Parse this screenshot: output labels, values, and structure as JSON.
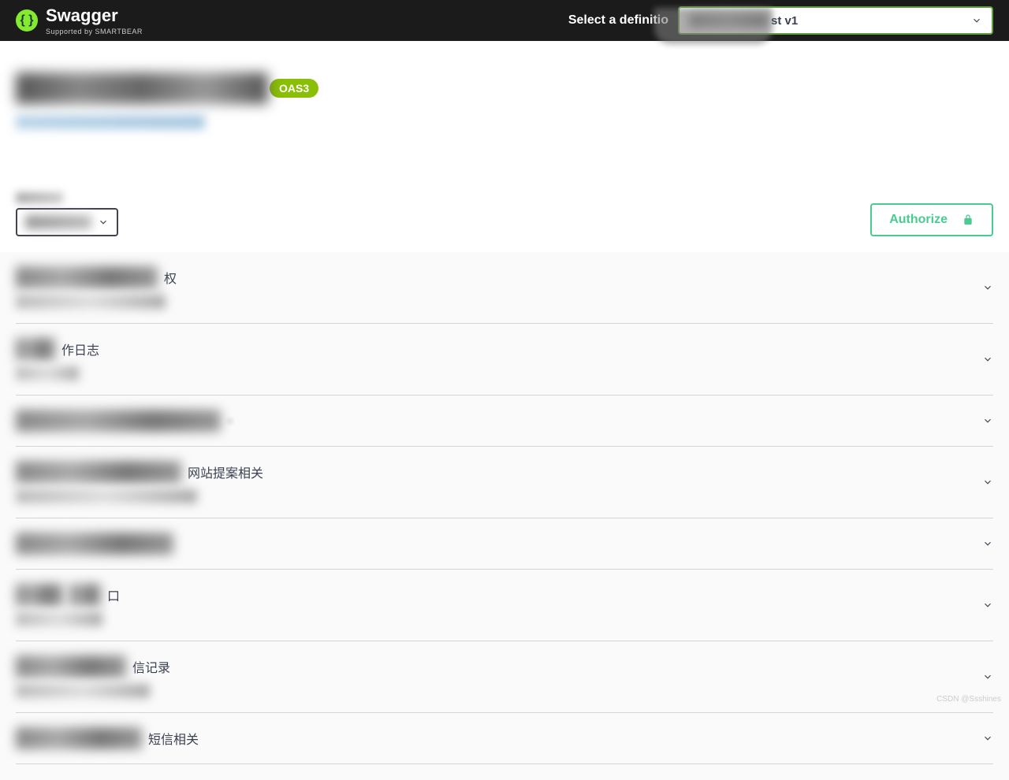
{
  "topbar": {
    "logo_text": "Swagger",
    "logo_sub": "Supported by SMARTBEAR",
    "def_label": "Select a definitio",
    "def_select_suffix": "st v1"
  },
  "info": {
    "oas_badge": "OAS3"
  },
  "scheme": {
    "authorize_label": "Authorize"
  },
  "tags": [
    {
      "redact_w": 180,
      "desc": "权",
      "sub_w": 190
    },
    {
      "redact_w": 50,
      "desc": "作日志",
      "sub_w": 80
    },
    {
      "redact_w": 260,
      "desc": "",
      "sub_w": 0,
      "extra_dot": true
    },
    {
      "redact_w": 210,
      "desc": "网站提案相关",
      "sub_w": 230
    },
    {
      "redact_w": 200,
      "desc": "",
      "sub_w": 0
    },
    {
      "redact_w": 60,
      "desc": "口",
      "sub_w": 110,
      "gap_redact_w": 40
    },
    {
      "redact_w": 140,
      "desc": "信记录",
      "sub_w": 170
    },
    {
      "redact_w": 160,
      "desc": "短信相关",
      "sub_w": 0
    }
  ],
  "watermark": "CSDN @Ssshines"
}
